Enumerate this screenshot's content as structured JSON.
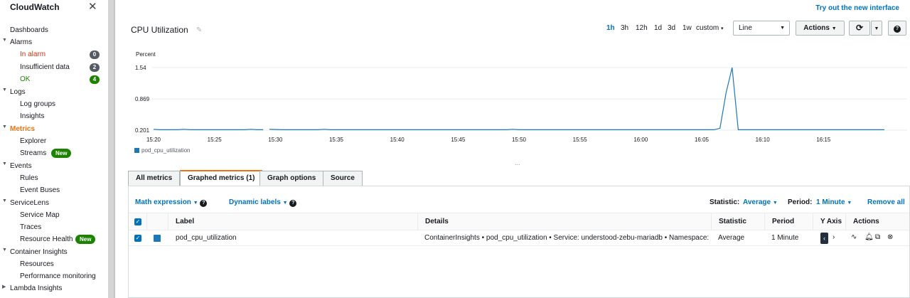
{
  "sidebar": {
    "title": "CloudWatch",
    "items": [
      {
        "label": "Dashboards"
      },
      {
        "label": "Alarms"
      },
      {
        "label": "In alarm",
        "badge": "0"
      },
      {
        "label": "Insufficient data",
        "badge": "2"
      },
      {
        "label": "OK",
        "badge": "4"
      },
      {
        "label": "Logs"
      },
      {
        "label": "Log groups"
      },
      {
        "label": "Insights"
      },
      {
        "label": "Metrics"
      },
      {
        "label": "Explorer"
      },
      {
        "label": "Streams",
        "tag": "New"
      },
      {
        "label": "Events"
      },
      {
        "label": "Rules"
      },
      {
        "label": "Event Buses"
      },
      {
        "label": "ServiceLens"
      },
      {
        "label": "Service Map"
      },
      {
        "label": "Traces"
      },
      {
        "label": "Resource Health",
        "tag": "New"
      },
      {
        "label": "Container Insights"
      },
      {
        "label": "Resources"
      },
      {
        "label": "Performance monitoring"
      },
      {
        "label": "Lambda Insights"
      }
    ]
  },
  "header": {
    "try_new": "Try out the new interface",
    "graph_title": "CPU Utilization",
    "ranges": [
      "1h",
      "3h",
      "12h",
      "1d",
      "3d",
      "1w",
      "custom"
    ],
    "view_type": "Line",
    "actions_label": "Actions"
  },
  "chart_data": {
    "type": "line",
    "ylabel": "Percent",
    "yticks": [
      "0.201",
      "0.869",
      "1.54"
    ],
    "ylim": [
      0.201,
      1.54
    ],
    "xticks": [
      "15:20",
      "15:25",
      "15:30",
      "15:35",
      "15:40",
      "15:45",
      "15:50",
      "15:55",
      "16:00",
      "16:05",
      "16:10",
      "16:15"
    ],
    "series": [
      {
        "name": "pod_cpu_utilization",
        "color": "#1f77b4",
        "x_minutes": [
          0,
          1,
          2,
          3,
          4,
          5,
          6,
          7,
          8,
          9,
          10,
          11,
          12,
          13,
          14,
          15,
          16,
          17,
          18,
          19,
          21,
          22,
          23,
          24,
          25,
          26,
          27,
          28,
          29,
          30,
          31,
          32,
          33,
          34,
          35,
          36,
          37,
          38,
          39,
          40,
          41,
          42,
          43,
          44,
          45,
          46,
          47,
          48,
          49,
          50,
          51,
          52,
          53,
          54,
          55,
          56,
          57,
          58,
          59,
          60,
          61,
          62,
          63,
          64,
          65,
          66,
          67,
          68,
          69,
          70,
          71,
          72,
          73,
          74,
          75,
          76,
          77,
          78,
          79,
          80,
          81,
          82,
          83,
          84,
          85,
          86,
          87,
          88,
          89,
          90,
          91,
          92,
          93,
          94,
          95,
          96,
          97,
          98,
          99,
          100,
          101,
          102,
          103,
          104,
          105,
          106,
          107,
          108,
          109,
          110,
          111,
          112,
          113,
          114,
          115,
          116,
          117,
          118,
          119,
          120
        ],
        "gap_after_minute": 17,
        "values": [
          0.22,
          0.21,
          0.21,
          0.21,
          0.21,
          0.22,
          0.21,
          0.21,
          0.21,
          0.21,
          0.21,
          0.21,
          0.21,
          0.21,
          0.21,
          0.21,
          0.22,
          0.21,
          0.21,
          0.22,
          0.21,
          0.21,
          0.21,
          0.21,
          0.21,
          0.21,
          0.21,
          0.22,
          0.21,
          0.21,
          0.21,
          0.21,
          0.21,
          0.21,
          0.21,
          0.21,
          0.21,
          0.21,
          0.21,
          0.21,
          0.21,
          0.21,
          0.21,
          0.21,
          0.21,
          0.21,
          0.21,
          0.21,
          0.21,
          0.21,
          0.21,
          0.21,
          0.21,
          0.21,
          0.21,
          0.21,
          0.21,
          0.21,
          0.22,
          0.21,
          0.21,
          0.21,
          0.21,
          0.21,
          0.21,
          0.21,
          0.21,
          0.21,
          0.21,
          0.21,
          0.21,
          0.21,
          0.21,
          0.21,
          0.21,
          0.21,
          0.21,
          0.21,
          0.21,
          0.21,
          0.21,
          0.21,
          0.21,
          0.21,
          0.21,
          0.21,
          0.21,
          0.21,
          0.21,
          0.21,
          0.21,
          0.21,
          0.21,
          0.21,
          0.21,
          0.21,
          0.21,
          0.21,
          0.21,
          0.21,
          0.21,
          0.21,
          0.21,
          0.21,
          0.21,
          0.21,
          0.21,
          0.21,
          0.21,
          0.21,
          0.21,
          0.21,
          0.21,
          0.21,
          0.21,
          0.21,
          0.21,
          0.21,
          0.21,
          0.21
        ]
      }
    ],
    "spike": {
      "minute_start": 92,
      "peak_minute": 95,
      "peak_value": 1.54,
      "shoulder_value": 1.0
    },
    "legend_position": "bottom-left",
    "grid": true
  },
  "tabs": [
    "All metrics",
    "Graphed metrics (1)",
    "Graph options",
    "Source"
  ],
  "toolbar": {
    "math_expression": "Math expression",
    "dynamic_labels": "Dynamic labels",
    "statistic_label": "Statistic:",
    "statistic_value": "Average",
    "period_label": "Period:",
    "period_value": "1 Minute",
    "remove_all": "Remove all"
  },
  "table": {
    "headers": [
      "Label",
      "Details",
      "Statistic",
      "Period",
      "Y Axis",
      "Actions"
    ],
    "row": {
      "label": "pod_cpu_utilization",
      "details": "ContainerInsights • pod_cpu_utilization • Service: understood-zebu-mariadb • Namespace: ...",
      "statistic": "Average",
      "period": "1 Minute",
      "color": "#1f77b4"
    }
  },
  "dots": "..."
}
